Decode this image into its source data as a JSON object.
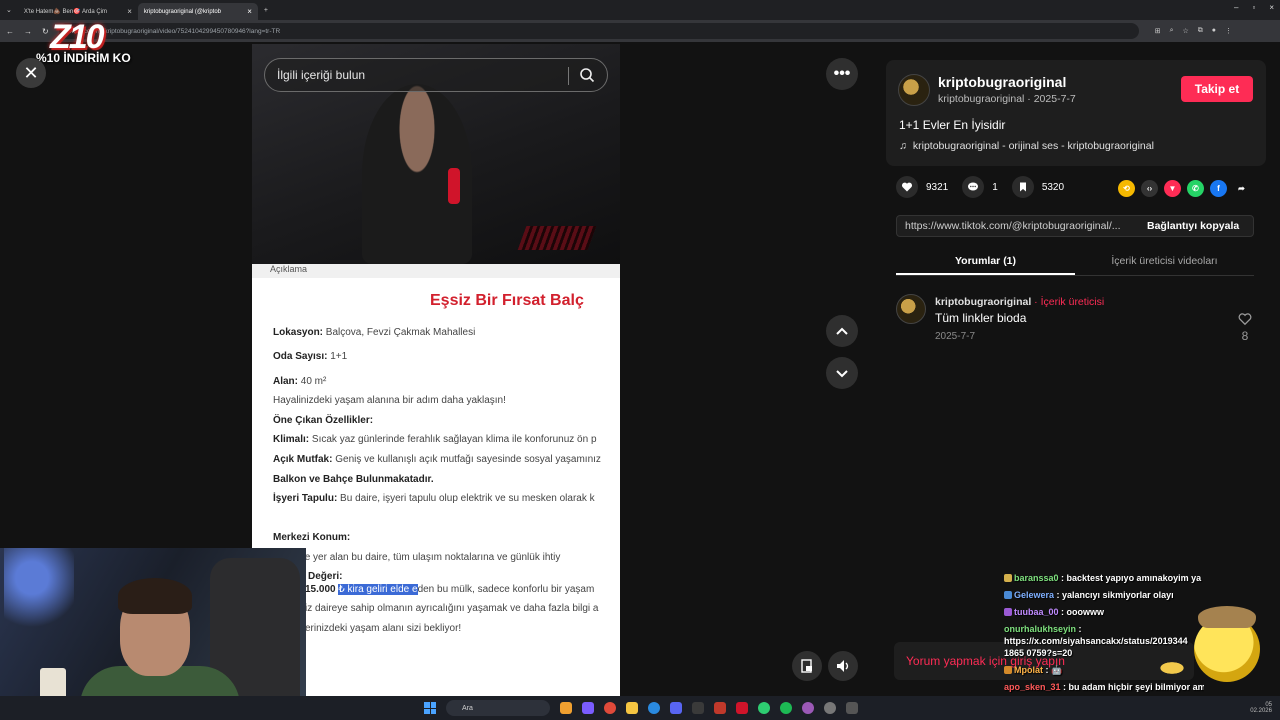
{
  "browser": {
    "tabs": [
      {
        "label": "X'te Hatem💩 Ben🎯 Arda Çim",
        "active": false
      },
      {
        "label": "kriptobugraoriginal (@kriptob",
        "active": true
      }
    ],
    "url": "tiktok.com/@kriptobugraoriginal/video/7524104299450780946?lang=tr-TR"
  },
  "overlay_brand": {
    "logo": "Z10",
    "promo": "%10 İNDİRİM KO"
  },
  "video": {
    "search_placeholder": "İlgili içeriği bulun",
    "document": {
      "header": "Açıklama",
      "title": "Eşsiz Bir Fırsat Balç",
      "lines": [
        {
          "label": "Lokasyon:",
          "text": " Balçova, Fevzi Çakmak Mahallesi"
        },
        {
          "label": "Oda Sayısı:",
          "text": " 1+1"
        },
        {
          "label": "Alan:",
          "text": " 40 m²"
        },
        {
          "label": "",
          "text": "Hayalinizdeki yaşam alanına bir adım daha yaklaşın!"
        },
        {
          "label": "Öne Çıkan Özellikler:",
          "text": ""
        },
        {
          "label": "Klimalı:",
          "text": " Sıcak yaz günlerinde ferahlık sağlayan klima ile konforunuz ön p"
        },
        {
          "label": "Açık Mutfak:",
          "text": " Geniş ve kullanışlı açık mutfağı sayesinde sosyal yaşamınız"
        },
        {
          "label": "Balkon ve Bahçe Bulunmakatadır.",
          "text": ""
        },
        {
          "label": "İşyeri Tapulu:",
          "text": " Bu daire, işyeri tapulu olup elektrik ve su mesken olarak k"
        },
        {
          "label": "Merkezi Konum:",
          "text": ""
        },
        {
          "label": "",
          "text": "kalbinde yer alan bu daire, tüm ulaşım noktalarına ve günlük ihtiy"
        },
        {
          "label": "Değeri:",
          "text": ""
        },
        {
          "label": "",
          "pre": "15.000 ",
          "highlight": "₺ kira geliri elde e",
          "text": "den bu mülk, sadece konforlu bir yaşam"
        },
        {
          "label": "",
          "text": "iz daireye sahip olmanın ayrıcalığını yaşamak ve daha fazla bilgi a"
        },
        {
          "label": "",
          "text": "erinizdeki yaşam alanı sizi bekliyor!"
        }
      ]
    }
  },
  "profile": {
    "username": "kriptobugraoriginal",
    "subline": "kriptobugraoriginal · 2025-7-7",
    "follow_label": "Takip et",
    "caption": "1+1 Evler En İyisidir",
    "sound": "kriptobugraoriginal - orijinal ses - kriptobugraoriginal"
  },
  "stats": {
    "likes": "9321",
    "comments": "1",
    "saves": "5320"
  },
  "link": {
    "url": "https://www.tiktok.com/@kriptobugraoriginal/...",
    "copy_label": "Bağlantıyı kopyala"
  },
  "tabs": [
    {
      "label": "Yorumlar (1)",
      "active": true
    },
    {
      "label": "İçerik üreticisi videoları",
      "active": false
    }
  ],
  "comment": {
    "author": "kriptobugraoriginal",
    "badge": " · İçerik üreticisi",
    "text": "Tüm linkler bioda",
    "date": "2025-7-7",
    "likes": "8"
  },
  "comment_input_placeholder": "Yorum yapmak için giriş yapın",
  "chat": [
    {
      "user": "baranssa0",
      "text": " : backtest yapıyo amınakoyim ya",
      "color": "#7ee07e",
      "icon": "#d4b04c"
    },
    {
      "user": "Gelewera",
      "text": " : yalancıyı sikmiyorlar olayı",
      "color": "#7fb0ff",
      "icon": "#4a8ad4"
    },
    {
      "user": "tuubaa_00",
      "text": " : ooowww",
      "color": "#c08bff",
      "icon": "#9a5ad4"
    },
    {
      "user": "onurhalukhseyin",
      "text": " : https://x.com/siyahsancakx/status/2019344 1865 0759?s=20",
      "color": "#7ee07e",
      "icon": ""
    },
    {
      "user": "Mpolat",
      "text": " : 🤖",
      "color": "#ffb347",
      "icon": "#d48a2a"
    },
    {
      "user": "apo_sken_31",
      "text": " : bu adam hiçbir şeyi bilmiyor ama bu şeyi",
      "color": "#ff5a5a",
      "icon": ""
    }
  ],
  "taskbar": {
    "search": "Ara",
    "time": "05",
    "date": "02.2026"
  }
}
